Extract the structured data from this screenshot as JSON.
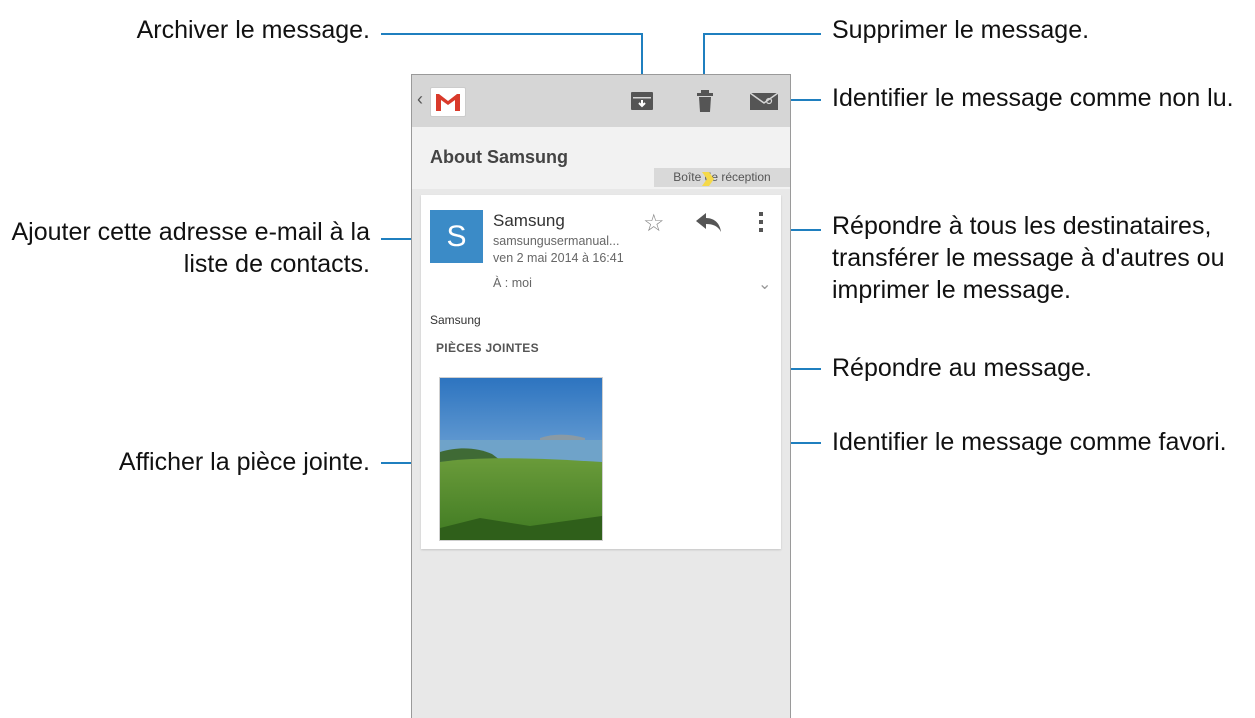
{
  "callouts": {
    "archive": "Archiver le message.",
    "delete": "Supprimer le message.",
    "unread": "Identifier le message comme non lu.",
    "add_contact_l1": "Ajouter cette adresse e-mail à la",
    "add_contact_l2": "liste de contacts.",
    "more_l1": "Répondre à tous les destinataires,",
    "more_l2": "transférer le message à d'autres ou",
    "more_l3": "imprimer le message.",
    "reply": "Répondre au message.",
    "favorite": "Identifier le message comme favori.",
    "attachment": "Afficher la pièce jointe."
  },
  "email": {
    "subject": "About Samsung",
    "label": "Boîte de réception",
    "avatar_letter": "S",
    "sender": "Samsung",
    "address": "samsungusermanual...",
    "date": "ven 2 mai 2014 à 16:41",
    "to": "À : moi",
    "body": "Samsung",
    "attachments_heading": "PIÈCES JOINTES"
  },
  "icons": {
    "back": "chevron-left-icon",
    "app": "gmail-icon",
    "archive": "archive-icon",
    "delete": "trash-icon",
    "unread": "envelope-icon",
    "star": "star-icon",
    "reply": "reply-icon",
    "more": "overflow-menu-icon",
    "expand": "chevron-down-icon"
  },
  "colors": {
    "callout_line": "#1f7fbf",
    "avatar_bg": "#3b8bc7",
    "label_arrow": "#f5d94a"
  }
}
